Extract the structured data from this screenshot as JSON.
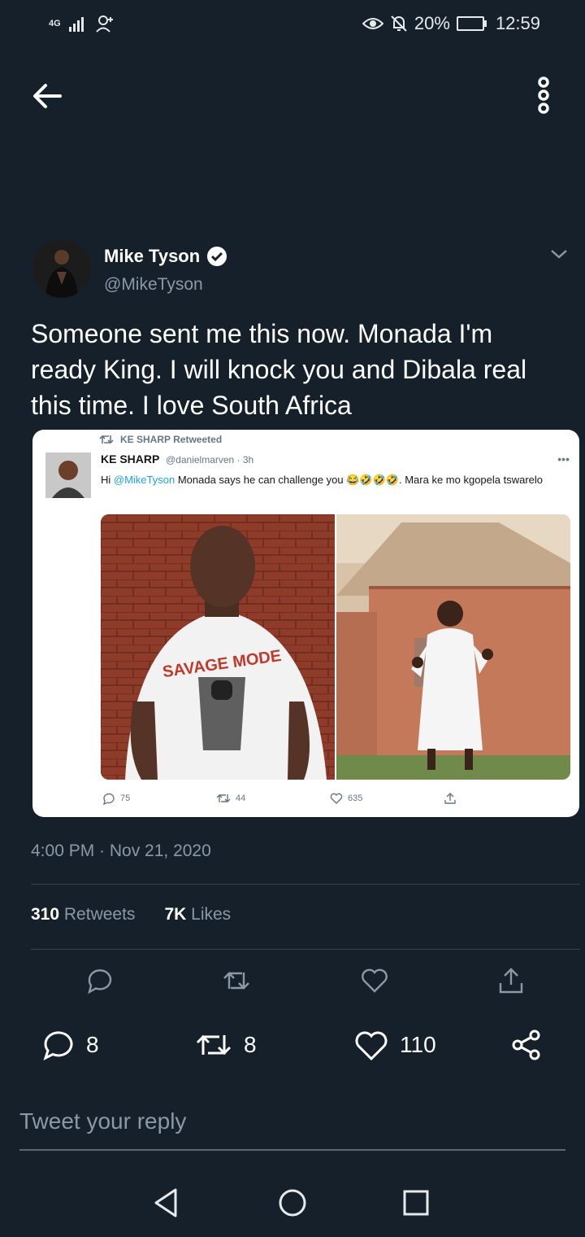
{
  "status_bar": {
    "network": "4G",
    "battery": "20%",
    "time": "12:59"
  },
  "tweet": {
    "author_name": "Mike Tyson",
    "author_handle": "@MikeTyson",
    "text": "Someone sent me this now. Monada I'm ready King. I will knock you and Dibala real this time. I love South Africa",
    "timestamp": "4:00 PM · Nov 21, 2020",
    "retweets_count": "310",
    "retweets_label": "Retweets",
    "likes_count": "7K",
    "likes_label": "Likes"
  },
  "embedded": {
    "retweeted_label": "KE SHARP Retweeted",
    "name": "KE SHARP",
    "handle": "@danielmarven · 3h",
    "text_prefix": "Hi ",
    "mention": "@MikeTyson",
    "text_suffix": " Monada says he can challenge you 😂🤣🤣🤣. Mara ke mo kgopela tswarelo",
    "shirt_text": "SAVAGE MODE",
    "replies": "75",
    "retweets": "44",
    "likes": "635"
  },
  "counts": {
    "replies": "8",
    "retweets": "8",
    "likes": "110"
  },
  "reply_box": {
    "placeholder": "Tweet your reply"
  },
  "colors": {
    "background": "#15202b",
    "secondary_text": "#8b98a5",
    "divider": "#38444d",
    "verified": "#ffffff"
  }
}
